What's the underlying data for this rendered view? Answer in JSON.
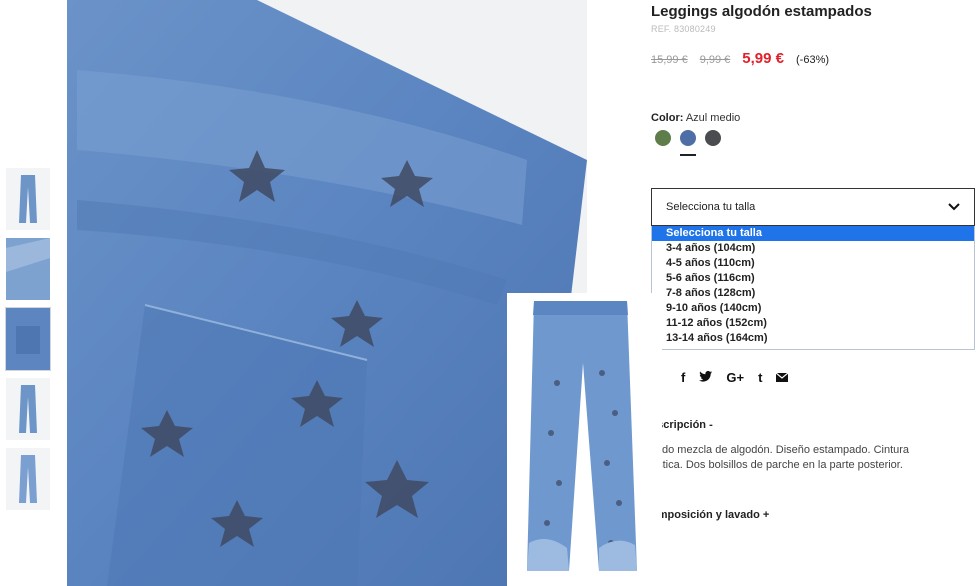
{
  "product": {
    "title": "Leggings algodón estampados",
    "ref": "REF. 83080249",
    "price_original": "15,99 €",
    "price_previous": "9,99 €",
    "price_sale": "5,99 €",
    "discount": "(-63%)"
  },
  "color": {
    "label": "Color:",
    "value": "Azul medio",
    "swatches": [
      {
        "name": "verde",
        "hex": "#5f7d4a"
      },
      {
        "name": "azul-medio",
        "hex": "#4e6fa6"
      },
      {
        "name": "gris",
        "hex": "#4a4c50"
      }
    ],
    "selected_index": 1
  },
  "size": {
    "placeholder": "Selecciona tu talla",
    "chevron_icon": "chevron-down-icon",
    "options": [
      "Selecciona tu talla",
      "3-4 años (104cm)",
      "4-5 años (110cm)",
      "5-6 años (116cm)",
      "7-8 años (128cm)",
      "9-10 años (140cm)",
      "11-12 años (152cm)",
      "13-14 años (164cm)"
    ],
    "highlighted_index": 0
  },
  "share": {
    "icons": [
      "facebook-icon",
      "twitter-icon",
      "google-plus-icon",
      "tumblr-icon",
      "email-icon"
    ],
    "glyphs": [
      "f",
      "🐦",
      "G+",
      "t",
      "✉"
    ]
  },
  "description": {
    "title": "escripción -",
    "text_line1": "ejido mezcla de algodón. Diseño estampado. Cintura",
    "text_line2": "ástica. Dos bolsillos de parche en la parte posterior.",
    "composition_title": "omposición y lavado +"
  }
}
